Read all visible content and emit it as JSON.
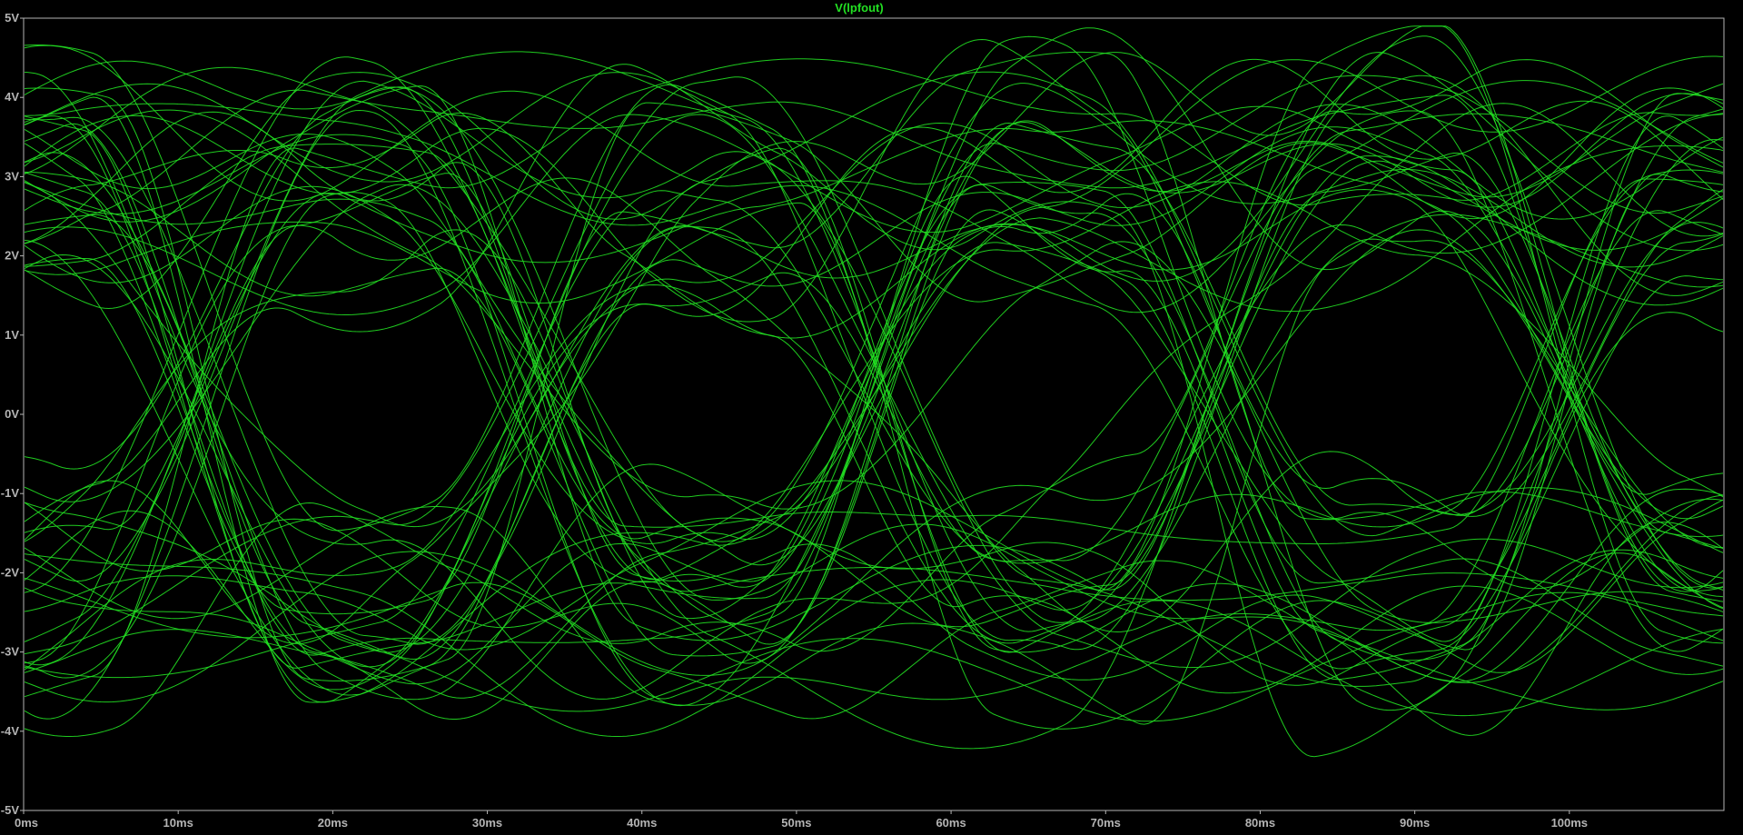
{
  "chart_data": {
    "type": "line",
    "title": "V(lpfout)",
    "xlabel": "",
    "ylabel": "",
    "xlim": [
      0,
      110
    ],
    "ylim": [
      -5,
      5
    ],
    "x_ticks": [
      "0ms",
      "10ms",
      "20ms",
      "30ms",
      "40ms",
      "50ms",
      "60ms",
      "70ms",
      "80ms",
      "90ms",
      "100ms"
    ],
    "x_tick_values": [
      0,
      10,
      20,
      30,
      40,
      50,
      60,
      70,
      80,
      90,
      100
    ],
    "y_ticks": [
      "5V",
      "4V",
      "3V",
      "2V",
      "1V",
      "0V",
      "-1V",
      "-2V",
      "-3V",
      "-4V",
      "-5V"
    ],
    "y_tick_values": [
      5,
      4,
      3,
      2,
      1,
      0,
      -1,
      -2,
      -3,
      -4,
      -5
    ],
    "grid": false,
    "eye_diagram": {
      "unit_interval_ms": 22,
      "first_crossing_ms": 11.5,
      "trace_count": 64,
      "level_high_v": 3,
      "level_low_v": -2.3,
      "crossing_v": 0.3
    },
    "colors": {
      "trace": "#22e022",
      "background": "#000000",
      "frame": "#b4b4b4",
      "tick_text": "#b4b4b4"
    },
    "series": [
      {
        "values": []
      }
    ]
  }
}
